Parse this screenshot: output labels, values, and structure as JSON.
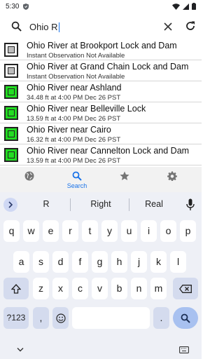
{
  "status_bar": {
    "time": "5:30",
    "icons": [
      "shield-icon",
      "wifi-icon",
      "signal-icon",
      "battery-icon"
    ]
  },
  "search": {
    "query": "Ohio R",
    "icons": [
      "search-icon",
      "clear-icon",
      "refresh-icon"
    ]
  },
  "results": [
    {
      "title": "Ohio River at Brookport Lock and Dam",
      "subtitle": "Instant Observation Not Available",
      "status": "unavailable"
    },
    {
      "title": "Ohio River at Grand Chain Lock and Dam",
      "subtitle": "Instant Observation Not Available",
      "status": "unavailable"
    },
    {
      "title": "Ohio River near Ashland",
      "subtitle": "34.48 ft at 4:00 PM Dec 26 PST",
      "status": "normal"
    },
    {
      "title": "Ohio River near Belleville Lock",
      "subtitle": "13.59 ft at 4:00 PM Dec 26 PST",
      "status": "normal"
    },
    {
      "title": "Ohio River near Cairo",
      "subtitle": "16.32 ft at 4:00 PM Dec 26 PST",
      "status": "normal"
    },
    {
      "title": "Ohio River near Cannelton Lock and Dam",
      "subtitle": "13.59 ft at 4:00 PM Dec 26 PST",
      "status": "normal"
    }
  ],
  "colors": {
    "status_normal": "#22dd22",
    "status_unavailable": "#bdbdbd",
    "accent": "#1a73e8"
  },
  "tabs": [
    {
      "icon": "globe-icon",
      "label": ""
    },
    {
      "icon": "search-icon",
      "label": "Search",
      "active": true
    },
    {
      "icon": "star-icon",
      "label": ""
    },
    {
      "icon": "gear-icon",
      "label": ""
    }
  ],
  "keyboard": {
    "suggestions": [
      "R",
      "Right",
      "Real"
    ],
    "row1": [
      "q",
      "w",
      "e",
      "r",
      "t",
      "y",
      "u",
      "i",
      "o",
      "p"
    ],
    "row2": [
      "a",
      "s",
      "d",
      "f",
      "g",
      "h",
      "j",
      "k",
      "l"
    ],
    "row3": [
      "z",
      "x",
      "c",
      "v",
      "b",
      "n",
      "m"
    ],
    "symbols_label": "?123",
    "comma_label": ",",
    "period_label": "."
  }
}
